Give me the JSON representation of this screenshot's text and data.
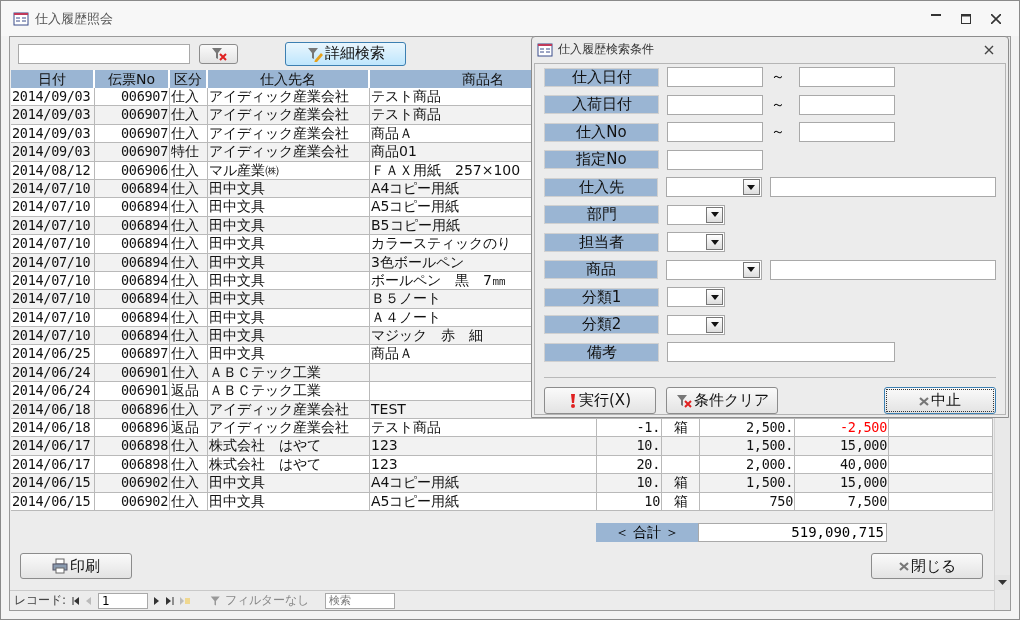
{
  "window": {
    "title": "仕入履歴照会"
  },
  "toolbar": {
    "detail_button": {
      "label": "詳細検索",
      "highlighted": true
    }
  },
  "table": {
    "columns": [
      "日付",
      "伝票No",
      "区分",
      "仕入先名",
      "商品名"
    ],
    "rows": [
      {
        "date": "2014/09/03",
        "no": "006907",
        "type": "仕入",
        "supplier": "アイディック産業会社",
        "product": "テスト商品"
      },
      {
        "date": "2014/09/03",
        "no": "006907",
        "type": "仕入",
        "supplier": "アイディック産業会社",
        "product": "テスト商品"
      },
      {
        "date": "2014/09/03",
        "no": "006907",
        "type": "仕入",
        "supplier": "アイディック産業会社",
        "product": "商品Ａ"
      },
      {
        "date": "2014/09/03",
        "no": "006907",
        "type": "特仕",
        "supplier": "アイディック産業会社",
        "product": "商品01"
      },
      {
        "date": "2014/08/12",
        "no": "006906",
        "type": "仕入",
        "supplier": "マル産業㈱",
        "product": "ＦＡＸ用紙　257×100"
      },
      {
        "date": "2014/07/10",
        "no": "006894",
        "type": "仕入",
        "supplier": "田中文具",
        "product": "A4コピー用紙"
      },
      {
        "date": "2014/07/10",
        "no": "006894",
        "type": "仕入",
        "supplier": "田中文具",
        "product": "A5コピー用紙"
      },
      {
        "date": "2014/07/10",
        "no": "006894",
        "type": "仕入",
        "supplier": "田中文具",
        "product": "B5コピー用紙"
      },
      {
        "date": "2014/07/10",
        "no": "006894",
        "type": "仕入",
        "supplier": "田中文具",
        "product": "カラースティックのり"
      },
      {
        "date": "2014/07/10",
        "no": "006894",
        "type": "仕入",
        "supplier": "田中文具",
        "product": "3色ボールペン"
      },
      {
        "date": "2014/07/10",
        "no": "006894",
        "type": "仕入",
        "supplier": "田中文具",
        "product": "ボールペン　黒　7㎜"
      },
      {
        "date": "2014/07/10",
        "no": "006894",
        "type": "仕入",
        "supplier": "田中文具",
        "product": "Ｂ５ノート"
      },
      {
        "date": "2014/07/10",
        "no": "006894",
        "type": "仕入",
        "supplier": "田中文具",
        "product": "Ａ４ノート"
      },
      {
        "date": "2014/07/10",
        "no": "006894",
        "type": "仕入",
        "supplier": "田中文具",
        "product": "マジック　赤　細"
      },
      {
        "date": "2014/06/25",
        "no": "006897",
        "type": "仕入",
        "supplier": "田中文具",
        "product": "商品Ａ"
      },
      {
        "date": "2014/06/24",
        "no": "006901",
        "type": "仕入",
        "supplier": "ＡＢＣテック工業"
      },
      {
        "date": "2014/06/24",
        "no": "006901",
        "type": "返品",
        "supplier": "ＡＢＣテック工業"
      },
      {
        "date": "2014/06/18",
        "no": "006896",
        "type": "仕入",
        "supplier": "アイディック産業会社",
        "product": "TEST"
      },
      {
        "date": "2014/06/18",
        "no": "006896",
        "type": "返品",
        "supplier": "アイディック産業会社",
        "product": "テスト商品",
        "qty": "-1.",
        "unit": "箱",
        "price": "2,500.",
        "amount": "-2,500",
        "negative": true
      },
      {
        "date": "2014/06/17",
        "no": "006898",
        "type": "仕入",
        "supplier": "株式会社　はやて",
        "product": "123",
        "qty": "10.",
        "price": "1,500.",
        "amount": "15,000",
        "negative": false
      },
      {
        "date": "2014/06/17",
        "no": "006898",
        "type": "仕入",
        "supplier": "株式会社　はやて",
        "product": "123",
        "qty": "20.",
        "price": "2,000.",
        "amount": "40,000",
        "negative": false
      },
      {
        "date": "2014/06/15",
        "no": "006902",
        "type": "仕入",
        "supplier": "田中文具",
        "product": "A4コピー用紙",
        "qty": "10.",
        "unit": "箱",
        "price": "1,500.",
        "amount": "15,000",
        "negative": false
      },
      {
        "date": "2014/06/15",
        "no": "006902",
        "type": "仕入",
        "supplier": "田中文具",
        "product": "A5コピー用紙",
        "qty": "10",
        "unit": "箱",
        "price": "750",
        "amount": "7,500",
        "negative": false
      }
    ]
  },
  "total": {
    "label": "＜ 合計 ＞",
    "value": "519,090,715"
  },
  "buttons": [
    {
      "kind": "print",
      "label": "印刷"
    },
    {
      "kind": "close",
      "label": "閉じる"
    }
  ],
  "status_bar": {
    "record_label": "レコード:",
    "record_value": "1",
    "filter_label": "フィルターなし",
    "search_placeholder": "検索"
  },
  "dialog": {
    "title": "仕入履歴検索条件",
    "fields": [
      {
        "label": "仕入日付",
        "kind": "range",
        "separator": "～"
      },
      {
        "label": "入荷日付",
        "kind": "range",
        "separator": "～"
      },
      {
        "label": "仕入No",
        "kind": "range",
        "separator": "～"
      },
      {
        "label": "指定No",
        "kind": "text"
      },
      {
        "label": "仕入先",
        "kind": "combo_text"
      },
      {
        "label": "部門",
        "kind": "combo"
      },
      {
        "label": "担当者",
        "kind": "combo"
      },
      {
        "label": "商品",
        "kind": "combo_text"
      },
      {
        "label": "分類1",
        "kind": "combo"
      },
      {
        "label": "分類2",
        "kind": "combo"
      },
      {
        "label": "備考",
        "kind": "memo"
      }
    ],
    "buttons": [
      {
        "kind": "run",
        "label": "実行(X)",
        "focused": false
      },
      {
        "kind": "clear",
        "label": "条件クリア",
        "focused": false
      },
      {
        "kind": "cancel",
        "label": "中止",
        "focused": true
      }
    ]
  }
}
